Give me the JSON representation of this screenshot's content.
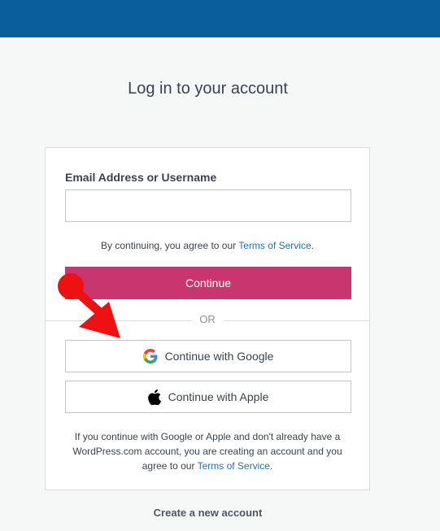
{
  "header": {
    "bar_color": "#0a5e9c"
  },
  "page": {
    "title": "Log in to your account"
  },
  "login_form": {
    "email_label": "Email Address or Username",
    "email_value": "",
    "email_placeholder": "",
    "tos_prefix": "By continuing, you agree to our ",
    "tos_link": "Terms of Service",
    "tos_suffix": ".",
    "continue_label": "Continue",
    "or_label": "OR",
    "google_label": "Continue with Google",
    "apple_label": "Continue with Apple",
    "footnote_prefix": "If you continue with Google or Apple and don't already have a WordPress.com account, you are creating an account and you agree to our ",
    "footnote_link": "Terms of Service",
    "footnote_suffix": "."
  },
  "footer": {
    "create_account_label": "Create a new account"
  },
  "colors": {
    "accent": "#c9356e",
    "link": "#2271b1",
    "annotation": "#ee1111"
  }
}
